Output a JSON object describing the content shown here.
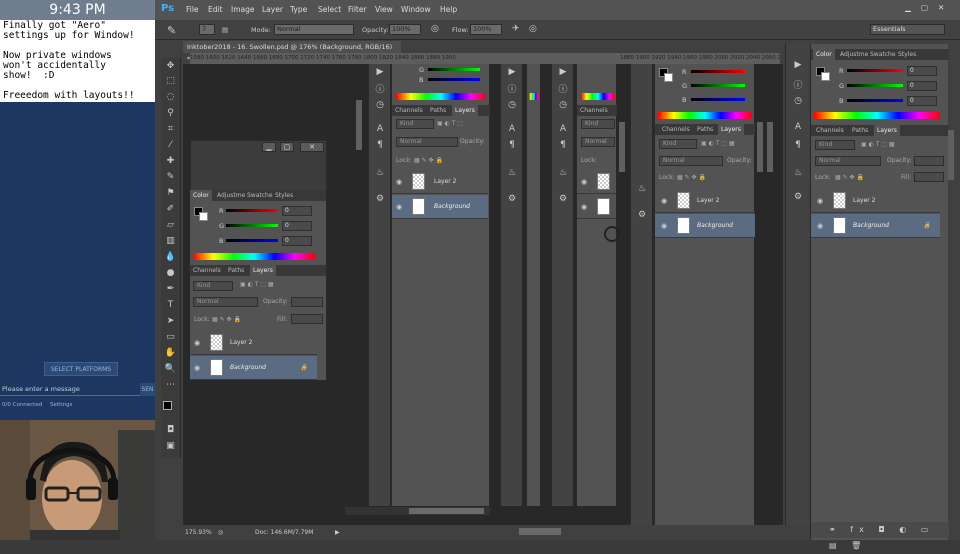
{
  "stream": {
    "clock": "9:43 PM",
    "notepad_text": "Finally got \"Aero\"\nsettings up for Window!\n\nNow private windows\nwon't accidentally\nshow!  :D\n\nFreeedom with layouts!!",
    "select_platforms": "SELECT PLATFORMS",
    "message_placeholder": "Please enter a message",
    "send_label": "SEN",
    "connected": "0/0 Connected",
    "settings": "Settings"
  },
  "ps": {
    "logo": "Ps",
    "menu": [
      "File",
      "Edit",
      "Image",
      "Layer",
      "Type",
      "Select",
      "Filter",
      "View",
      "Window",
      "Help"
    ],
    "options": {
      "mode_label": "Mode:",
      "mode_value": "Normal",
      "opacity_label": "Opacity:",
      "opacity_value": "100%",
      "flow_label": "Flow:",
      "flow_value": "100%",
      "brush_size": "7",
      "workspace": "Essentials"
    },
    "doc_tab": "Inktober2018 - 16. Swollen.psd @ 176% (Background, RGB/16) *",
    "ruler_text": "1580  1600  1620  1640  1660  1680  1700  1720  1740  1760  1780  1800  1820  1840  1860  1880  1900",
    "ruler_text_right": "1880  1900  1920  1940  1960  1980  2000  2020  2040  2060  2080",
    "status_zoom": "175.93%",
    "status_doc": "Doc: 146.6M/7.79M",
    "panels": {
      "color_tabs": [
        "Color",
        "Adjustme",
        "Swatche",
        "Styles"
      ],
      "layer_tabs": [
        "Channels",
        "Paths",
        "Layers"
      ],
      "rgb": [
        "R",
        "G",
        "B"
      ],
      "rgb_values": [
        "0",
        "0",
        "0"
      ],
      "kind": "Kind",
      "blend": "Normal",
      "opacity_label": "Opacity:",
      "lock_label": "Lock:",
      "fill_label": "Fill:",
      "layer2": "Layer 2",
      "background": "Background"
    }
  }
}
